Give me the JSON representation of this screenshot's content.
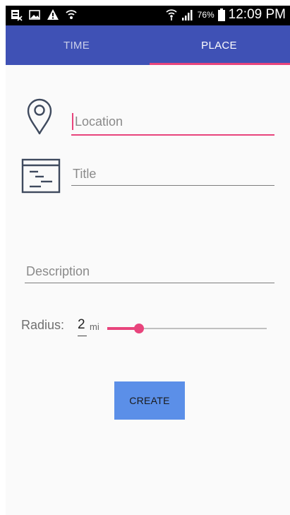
{
  "status_bar": {
    "battery": "76%",
    "time": "12:09 PM",
    "icons": [
      "sim-card-icon",
      "image-icon",
      "warning-icon",
      "wifi-icon",
      "wifi-calling-icon",
      "signal-icon",
      "battery-icon"
    ]
  },
  "tabs": [
    {
      "label": "TIME",
      "active": false
    },
    {
      "label": "PLACE",
      "active": true
    }
  ],
  "form": {
    "location": {
      "value": "",
      "placeholder": "Location",
      "focused": true
    },
    "title": {
      "value": "",
      "placeholder": "Title"
    },
    "description": {
      "value": "",
      "placeholder": "Description"
    },
    "radius": {
      "label": "Radius:",
      "value": "2",
      "unit": "mi",
      "slider_fraction": 0.2
    }
  },
  "create_button": {
    "label": "CREATE"
  },
  "colors": {
    "primary": "#3f51b5",
    "accent": "#e8447c",
    "button": "#5b8fe8",
    "background": "#fafafa"
  }
}
